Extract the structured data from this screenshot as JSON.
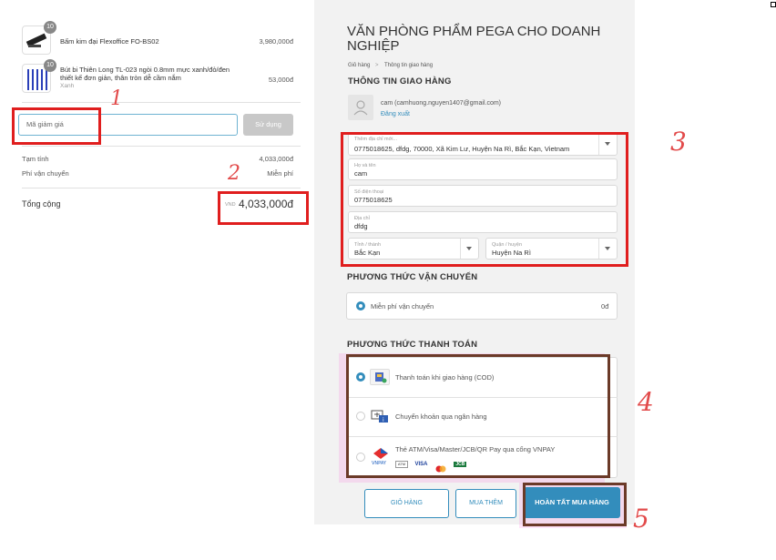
{
  "order": {
    "items": [
      {
        "name": "Bấm kim đại Flexoffice FO-BS02",
        "variant": "",
        "qty": "10",
        "price": "3,980,000đ"
      },
      {
        "name_line1": "Bút bi Thiên Long TL-023 ngòi 0.8mm mực xanh/đỏ/đen",
        "name_line2": "thiết kế đơn giản, thân tròn dễ cầm nắm",
        "variant": "Xanh",
        "qty": "10",
        "price": "53,000đ"
      }
    ],
    "coupon_placeholder": "Mã giảm giá",
    "coupon_button": "Sử dụng",
    "subtotal_label": "Tạm tính",
    "subtotal_value": "4,033,000đ",
    "shipping_label": "Phí vận chuyển",
    "shipping_value": "Miễn phí",
    "total_label": "Tổng cộng",
    "currency": "VND",
    "total_value": "4,033,000đ"
  },
  "checkout": {
    "shop_title_line1": "VĂN PHÒNG PHẨM PEGA CHO DOANH",
    "shop_title_line2": "NGHIỆP",
    "breadcrumb": [
      "Giỏ hàng",
      "Thông tin giao hàng"
    ],
    "breadcrumb_sep": ">",
    "shipping_info_title": "THÔNG TIN GIAO HÀNG",
    "account_email": "cam (camhuong.nguyen1407@gmail.com)",
    "logout_label": "Đăng xuất",
    "fields": {
      "saved_address": {
        "label": "Thêm địa chỉ mới...",
        "value": "0775018625, dfdg, 70000, Xã Kim Lư, Huyện Na Rì, Bắc Kạn, Vietnam"
      },
      "full_name": {
        "label": "Họ và tên",
        "value": "cam"
      },
      "phone": {
        "label": "Số điện thoại",
        "value": "0775018625"
      },
      "address": {
        "label": "Địa chỉ",
        "value": "dfdg"
      },
      "province": {
        "label": "Tỉnh / thành",
        "value": "Bắc Kạn"
      },
      "district": {
        "label": "Quận / huyện",
        "value": "Huyện Na Rì"
      }
    },
    "shipping_method_title": "PHƯƠNG THỨC VẬN CHUYỂN",
    "shipping_option": "Miễn phí vận chuyển",
    "shipping_option_price": "0đ",
    "payment_method_title": "PHƯƠNG THỨC THANH TOÁN",
    "payment_options": [
      {
        "label": "Thanh toán khi giao hàng (COD)",
        "selected": true
      },
      {
        "label": "Chuyển khoản qua ngân hàng",
        "selected": false
      },
      {
        "label": "Thẻ ATM/Visa/Master/JCB/QR Pay qua cổng VNPAY",
        "selected": false,
        "brand": "VNPAY",
        "cards": [
          "ATM",
          "VISA",
          "JCB"
        ]
      }
    ],
    "buttons": {
      "cart": "GIỎ HÀNG",
      "continue": "MUA THÊM",
      "complete": "HOÀN TẤT MUA HÀNG"
    }
  },
  "annotations": [
    "1",
    "2",
    "3",
    "4",
    "5"
  ],
  "colors": {
    "accent": "#338dbc",
    "annotation_red": "#e01e1e",
    "annotation_brown": "#6b3a28",
    "panel_bg": "#f2f2f2"
  }
}
